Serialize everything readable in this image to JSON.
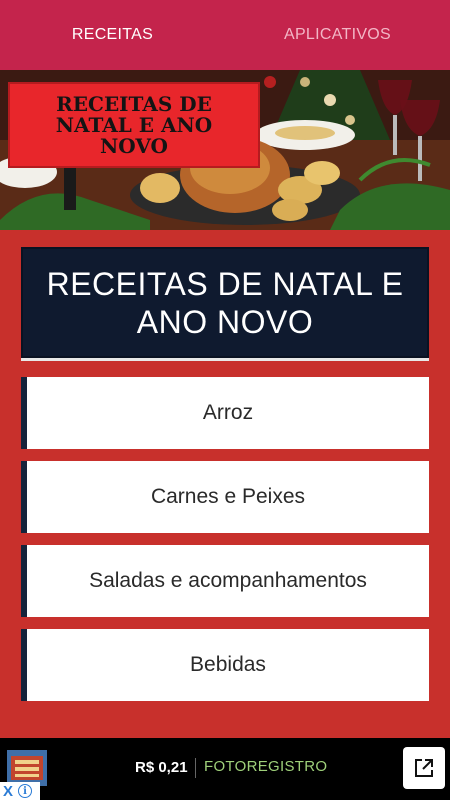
{
  "tabs": [
    {
      "label": "RECEITAS",
      "active": true
    },
    {
      "label": "APLICATIVOS",
      "active": false
    }
  ],
  "hero": {
    "banner_text": "RECEITAS DE NATAL E ANO NOVO"
  },
  "title_card": {
    "text": "RECEITAS DE NATAL E ANO NOVO"
  },
  "menu": [
    {
      "label": "Arroz"
    },
    {
      "label": "Carnes e Peixes"
    },
    {
      "label": "Saladas e acompanhamentos"
    },
    {
      "label": "Bebidas"
    }
  ],
  "ad": {
    "price": "R$ 0,21",
    "brand": "FOTOREGISTRO",
    "close_glyph": "X",
    "info_glyph": "i"
  },
  "colors": {
    "topbar": "#c4244c",
    "background": "#c8302c",
    "title_card": "#0f1a2f",
    "menu_accent": "#15233b"
  }
}
